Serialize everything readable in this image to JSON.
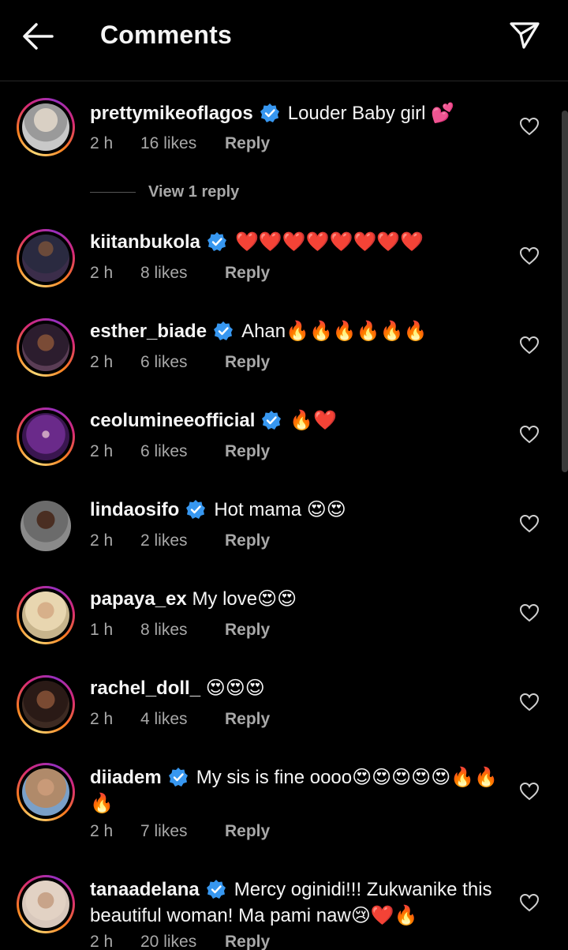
{
  "header": {
    "title": "Comments",
    "back_icon": "arrow-left-icon",
    "share_icon": "paper-plane-icon"
  },
  "colors": {
    "background": "#000000",
    "text": "#f5f5f5",
    "secondary_text": "#a8a8a8",
    "verified_badge": "#3797f0"
  },
  "comments": [
    {
      "username": "prettymikeoflagos",
      "verified": true,
      "text": "Louder Baby girl 💕",
      "time": "2 h",
      "likes": "16 likes",
      "reply": "Reply",
      "view_replies": "View 1 reply"
    },
    {
      "username": "kiitanbukola",
      "verified": true,
      "text": "❤️❤️❤️❤️❤️❤️❤️❤️",
      "time": "2 h",
      "likes": "8 likes",
      "reply": "Reply"
    },
    {
      "username": "esther_biade",
      "verified": true,
      "text": "Ahan🔥🔥🔥🔥🔥🔥",
      "time": "2 h",
      "likes": "6 likes",
      "reply": "Reply"
    },
    {
      "username": "ceolumineeofficial",
      "verified": true,
      "text": "🔥❤️",
      "time": "2 h",
      "likes": "6 likes",
      "reply": "Reply"
    },
    {
      "username": "lindaosifo",
      "verified": true,
      "text": "Hot mama 😍😍",
      "time": "2 h",
      "likes": "2 likes",
      "reply": "Reply"
    },
    {
      "username": "papaya_ex",
      "verified": false,
      "text": "My love😍😍",
      "time": "1 h",
      "likes": "8 likes",
      "reply": "Reply"
    },
    {
      "username": "rachel_doll_",
      "verified": false,
      "text": "😍😍😍",
      "time": "2 h",
      "likes": "4 likes",
      "reply": "Reply"
    },
    {
      "username": "diiadem",
      "verified": true,
      "text": "My sis is fine oooo😍😍😍😍😍🔥🔥🔥",
      "time": "2 h",
      "likes": "7 likes",
      "reply": "Reply"
    },
    {
      "username": "tanaadelana",
      "verified": true,
      "text": "Mercy oginidi!!! Zukwanike this beautiful woman! Ma pami naw😢❤️🔥",
      "time": "2 h",
      "likes": "20 likes",
      "reply": "Reply"
    }
  ]
}
